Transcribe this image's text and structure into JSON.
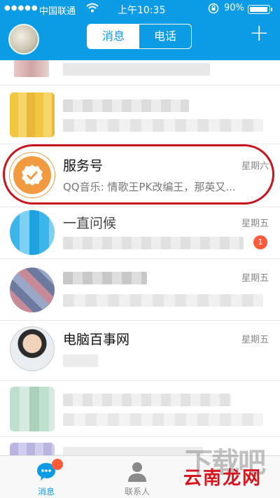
{
  "status_bar": {
    "signal": "●●●●●",
    "carrier": "中国联通",
    "time": "上午10:35",
    "battery": "90%"
  },
  "header": {
    "tabs": [
      "消息",
      "电话"
    ],
    "active_tab": "消息",
    "add_glyph": "+"
  },
  "conversations": [
    {
      "title": "服务号",
      "time": "星期六",
      "preview": "QQ音乐: 情歌王PK改编王，那英又..."
    },
    {
      "title": "一直问候",
      "time": "星期五",
      "badge": "1"
    },
    {
      "title": "",
      "time": "星期五"
    },
    {
      "title": "电脑百事网",
      "time": "星期五"
    }
  ],
  "tabbar": {
    "items": [
      {
        "label": "消息",
        "icon": "message-icon"
      },
      {
        "label": "联系人",
        "icon": "contacts-icon"
      }
    ]
  },
  "watermark": {
    "text": "下载吧",
    "site": "云南龙网"
  },
  "colors": {
    "accent": "#0c9ce6",
    "highlight_ring": "#c8141f",
    "badge": "#ff5a3a",
    "service_icon": "#f29a3f"
  }
}
